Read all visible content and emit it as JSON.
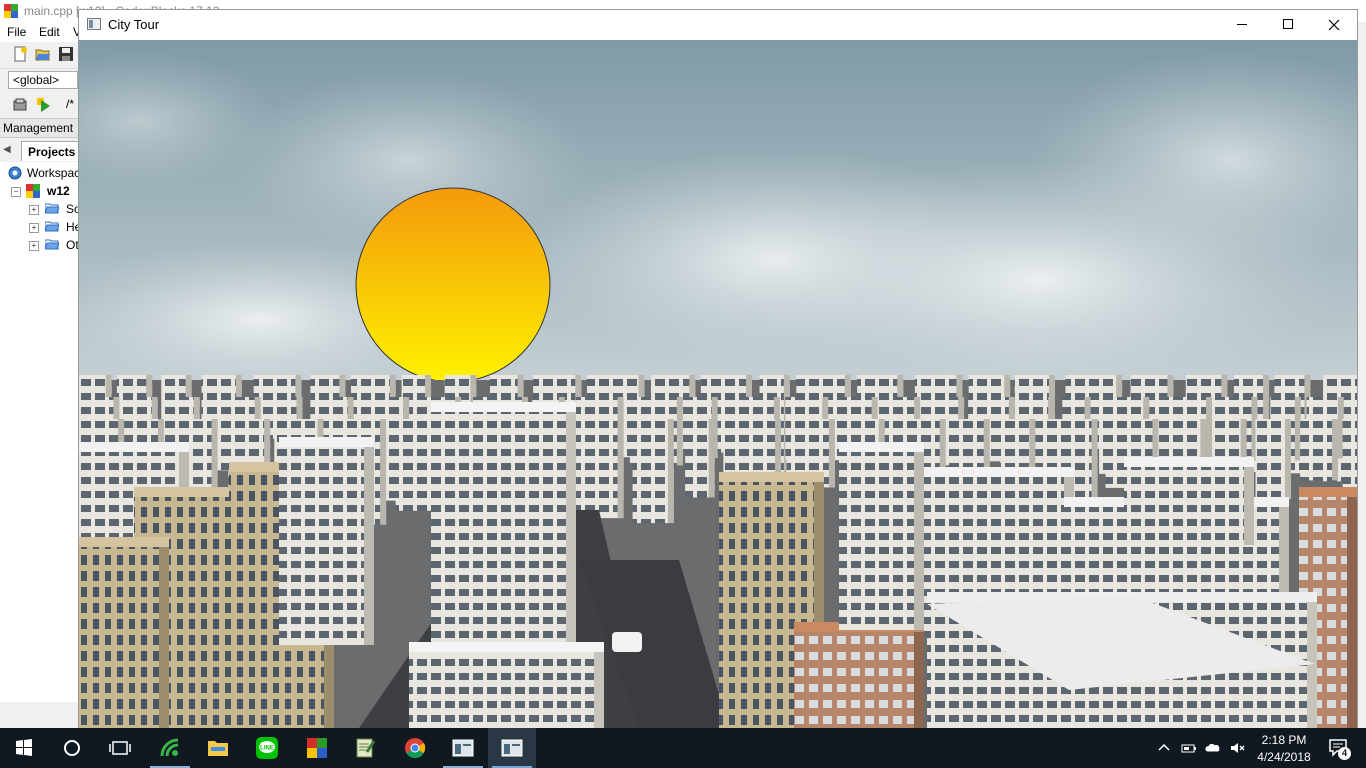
{
  "ide": {
    "title": "main.cpp [w12] - Code::Blocks 17.12",
    "menu": [
      "File",
      "Edit",
      "V"
    ],
    "scope": "<global>",
    "toolbar_comment": "/*",
    "management_label": "Management",
    "projects_tab": "Projects",
    "tree": {
      "workspace": "Workspace",
      "project": "w12",
      "folders": [
        "So",
        "He",
        "Ot"
      ]
    }
  },
  "window": {
    "title": "City Tour",
    "controls": {
      "minimize": "minimize-icon",
      "maximize": "maximize-icon",
      "close": "close-icon"
    }
  },
  "scene": {
    "sun_colors": {
      "top": "#f39a0c",
      "bottom": "#fff200"
    },
    "sky_colors": {
      "top": "#7f9aa6",
      "bottom": "#c7d2d6"
    }
  },
  "taskbar": {
    "apps": [
      {
        "name": "start-icon"
      },
      {
        "name": "cortana-icon"
      },
      {
        "name": "task-view-icon"
      },
      {
        "name": "codeblocks-icon"
      },
      {
        "name": "file-explorer-icon"
      },
      {
        "name": "line-icon"
      },
      {
        "name": "winrar-icon"
      },
      {
        "name": "notepad-icon"
      },
      {
        "name": "chrome-icon"
      },
      {
        "name": "app-window-icon"
      },
      {
        "name": "city-tour-window-icon"
      }
    ],
    "time": "2:18 PM",
    "date": "4/24/2018",
    "notification_count": "4"
  }
}
